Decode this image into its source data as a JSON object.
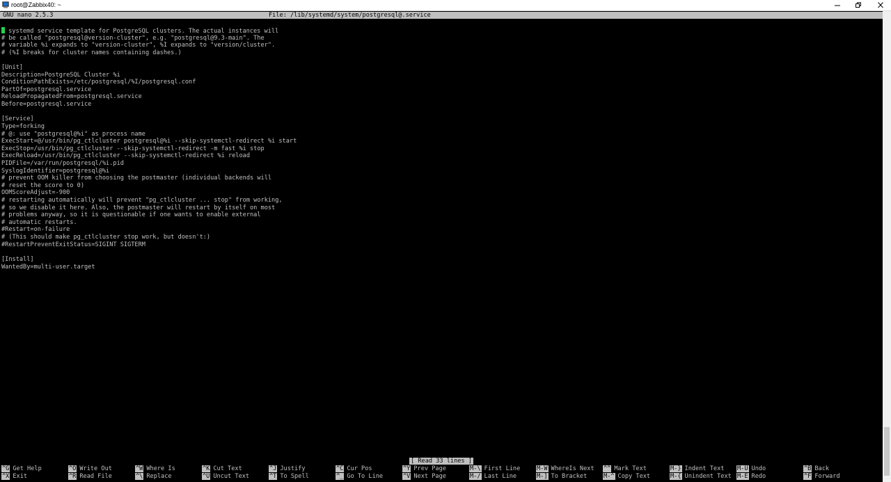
{
  "window": {
    "title": "root@Zabbix40: ~",
    "minimize_glyph": "–",
    "maximize_glyph": "❐",
    "close_glyph": "✕"
  },
  "nano": {
    "version": "GNU nano 2.5.3",
    "file_label": "File: /lib/systemd/system/postgresql@.service",
    "status": "[ Read 33 lines ]"
  },
  "editor": {
    "first_char": "#",
    "first_rest": " systemd service template for PostgreSQL clusters. The actual instances will",
    "lines": [
      "# be called \"postgresql@version-cluster\", e.g. \"postgresql@9.3-main\". The",
      "# variable %i expands to \"version-cluster\", %I expands to \"version/cluster\".",
      "# (%I breaks for cluster names containing dashes.)",
      "",
      "[Unit]",
      "Description=PostgreSQL Cluster %i",
      "ConditionPathExists=/etc/postgresql/%I/postgresql.conf",
      "PartOf=postgresql.service",
      "ReloadPropagatedFrom=postgresql.service",
      "Before=postgresql.service",
      "",
      "[Service]",
      "Type=forking",
      "# @: use \"postgresql@%i\" as process name",
      "ExecStart=@/usr/bin/pg_ctlcluster postgresql@%i --skip-systemctl-redirect %i start",
      "ExecStop=/usr/bin/pg_ctlcluster --skip-systemctl-redirect -m fast %i stop",
      "ExecReload=/usr/bin/pg_ctlcluster --skip-systemctl-redirect %i reload",
      "PIDFile=/var/run/postgresql/%i.pid",
      "SyslogIdentifier=postgresql@%i",
      "# prevent OOM killer from choosing the postmaster (individual backends will",
      "# reset the score to 0)",
      "OOMScoreAdjust=-900",
      "# restarting automatically will prevent \"pg_ctlcluster ... stop\" from working,",
      "# so we disable it here. Also, the postmaster will restart by itself on most",
      "# problems anyway, so it is questionable if one wants to enable external",
      "# automatic restarts.",
      "#Restart=on-failure",
      "# (This should make pg_ctlcluster stop work, but doesn't:)",
      "#RestartPreventExitStatus=SIGINT SIGTERM",
      "",
      "[Install]",
      "WantedBy=multi-user.target"
    ]
  },
  "shortcuts": {
    "row1": [
      {
        "key": "^G",
        "label": "Get Help"
      },
      {
        "key": "^O",
        "label": "Write Out"
      },
      {
        "key": "^W",
        "label": "Where Is"
      },
      {
        "key": "^K",
        "label": "Cut Text"
      },
      {
        "key": "^J",
        "label": "Justify"
      },
      {
        "key": "^C",
        "label": "Cur Pos"
      },
      {
        "key": "^Y",
        "label": "Prev Page"
      },
      {
        "key": "M-\\",
        "label": "First Line"
      },
      {
        "key": "M-W",
        "label": "WhereIs Next"
      },
      {
        "key": "^^",
        "label": "Mark Text"
      },
      {
        "key": "M-}",
        "label": "Indent Text"
      },
      {
        "key": "M-U",
        "label": "Undo"
      },
      {
        "key": "^B",
        "label": "Back"
      }
    ],
    "row2": [
      {
        "key": "^X",
        "label": "Exit"
      },
      {
        "key": "^R",
        "label": "Read File"
      },
      {
        "key": "^\\",
        "label": "Replace"
      },
      {
        "key": "^U",
        "label": "Uncut Text"
      },
      {
        "key": "^T",
        "label": "To Spell"
      },
      {
        "key": "^_",
        "label": "Go To Line"
      },
      {
        "key": "^V",
        "label": "Next Page"
      },
      {
        "key": "M-/",
        "label": "Last Line"
      },
      {
        "key": "M-]",
        "label": "To Bracket"
      },
      {
        "key": "M-^",
        "label": "Copy Text"
      },
      {
        "key": "M-{",
        "label": "Unindent Text"
      },
      {
        "key": "M-E",
        "label": "Redo"
      },
      {
        "key": "^F",
        "label": "Forward"
      }
    ]
  },
  "colors": {
    "terminal_bg": "#000000",
    "terminal_fg": "#c0c0c0",
    "inverse_bg": "#c0c0c0",
    "cursor": "#23d34b"
  }
}
